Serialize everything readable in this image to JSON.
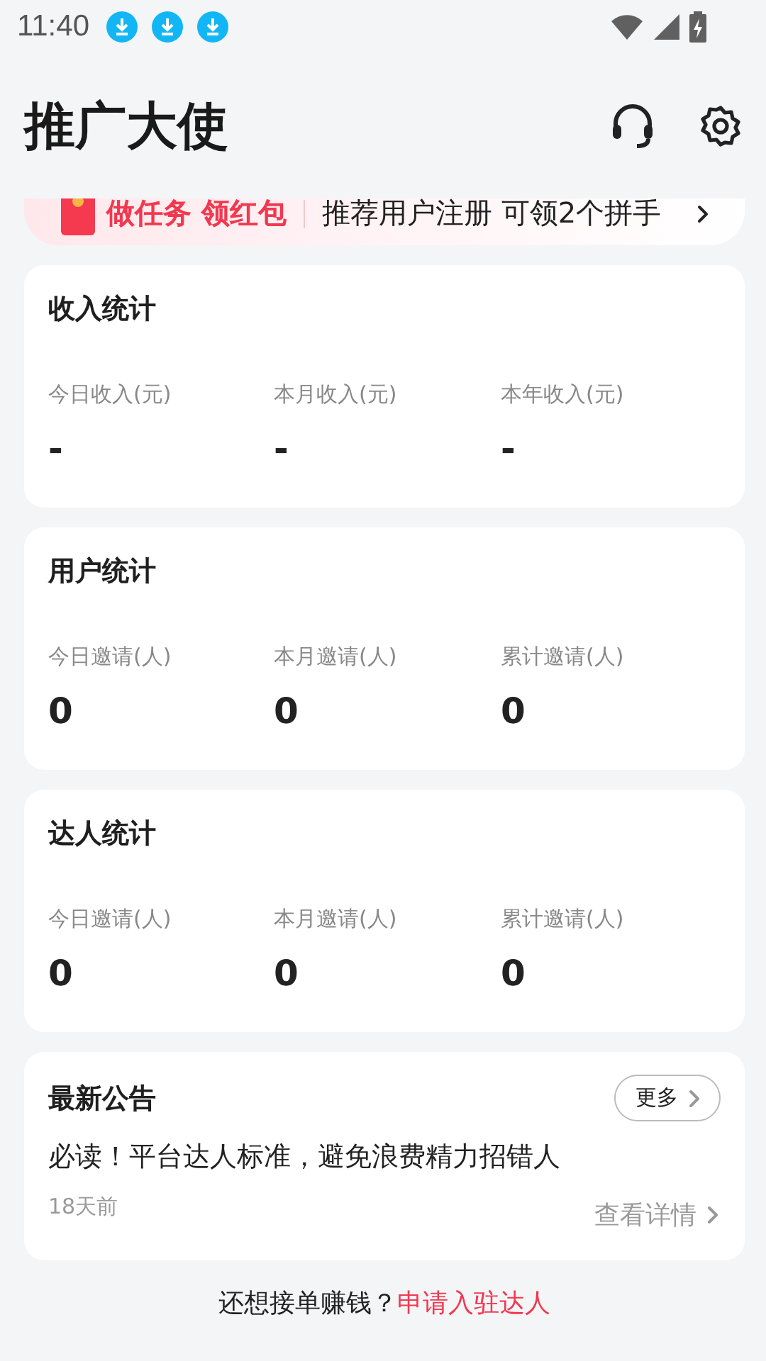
{
  "status_bar": {
    "time": "11:40",
    "notifications": [
      {
        "kind": "download"
      },
      {
        "kind": "download"
      },
      {
        "kind": "download"
      }
    ]
  },
  "header": {
    "title": "推广大使"
  },
  "banner": {
    "tag": "做任务 领红包",
    "text": "推荐用户注册 可领2个拼手"
  },
  "stat_cards": [
    {
      "title": "收入统计",
      "items": [
        {
          "label": "今日收入(元)",
          "value": "-"
        },
        {
          "label": "本月收入(元)",
          "value": "-"
        },
        {
          "label": "本年收入(元)",
          "value": "-"
        }
      ]
    },
    {
      "title": "用户统计",
      "items": [
        {
          "label": "今日邀请(人)",
          "value": "0"
        },
        {
          "label": "本月邀请(人)",
          "value": "0"
        },
        {
          "label": "累计邀请(人)",
          "value": "0"
        }
      ]
    },
    {
      "title": "达人统计",
      "items": [
        {
          "label": "今日邀请(人)",
          "value": "0"
        },
        {
          "label": "本月邀请(人)",
          "value": "0"
        },
        {
          "label": "累计邀请(人)",
          "value": "0"
        }
      ]
    }
  ],
  "notice": {
    "title": "最新公告",
    "more": "更多",
    "headline": "必读！平台达人标准，避免浪费精力招错人",
    "time": "18天前",
    "details": "查看详情"
  },
  "footer": {
    "prompt": "还想接单赚钱？",
    "link": "申请入驻达人"
  }
}
